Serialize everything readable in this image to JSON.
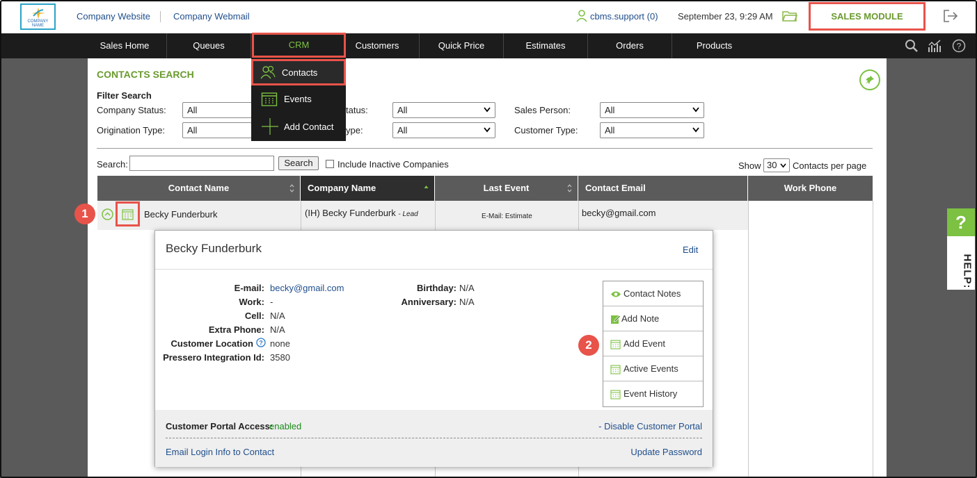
{
  "header": {
    "logo_text": "COMPANY NAME",
    "links": [
      "Company Website",
      "Company Webmail"
    ],
    "user": "cbms.support (0)",
    "datetime": "September 23, 9:29 AM",
    "module_button": "SALES MODULE"
  },
  "nav": {
    "items": [
      "Sales Home",
      "Queues",
      "CRM",
      "Customers",
      "Quick Price",
      "Estimates",
      "Orders",
      "Products"
    ],
    "crm_dropdown": [
      "Contacts",
      "Events",
      "Add Contact"
    ]
  },
  "page": {
    "title": "CONTACTS SEARCH",
    "filter_heading": "Filter Search",
    "filters": {
      "company_status_label": "Company Status:",
      "company_status_value": "All",
      "status_label_partial": "tatus:",
      "status_value": "All",
      "sales_person_label": "Sales Person:",
      "sales_person_value": "All",
      "origination_type_label": "Origination Type:",
      "origination_type_value": "All",
      "type_label_partial": "ype:",
      "type_value": "All",
      "customer_type_label": "Customer Type:",
      "customer_type_value": "All"
    },
    "search_label": "Search:",
    "search_button": "Search",
    "include_inactive_label": "Include Inactive Companies",
    "show_label": "Show",
    "per_page_value": "30",
    "per_page_suffix": "Contacts per page"
  },
  "table": {
    "columns": [
      "Contact Name",
      "Company Name",
      "Last Event",
      "Contact Email",
      "Work Phone"
    ],
    "row": {
      "contact_name": "Becky Funderburk",
      "company_name": "(IH) Becky Funderburk",
      "company_tag": "- Lead",
      "last_event": "E-Mail: Estimate",
      "email": "becky@gmail.com"
    }
  },
  "card": {
    "name": "Becky Funderburk",
    "edit": "Edit",
    "fields": [
      {
        "label": "E-mail:",
        "value": "becky@gmail.com"
      },
      {
        "label": "Work:",
        "value": "-"
      },
      {
        "label": "Cell:",
        "value": "N/A"
      },
      {
        "label": "Extra Phone:",
        "value": "N/A"
      },
      {
        "label": "Customer Location",
        "value": "none"
      },
      {
        "label": "Pressero Integration Id:",
        "value": "3580"
      }
    ],
    "fields_right": [
      {
        "label": "Birthday:",
        "value": "N/A"
      },
      {
        "label": "Anniversary:",
        "value": "N/A"
      }
    ],
    "actions": [
      "Contact Notes",
      "Add Note",
      "Add Event",
      "Active Events",
      "Event History"
    ],
    "portal_label": "Customer Portal Access:",
    "portal_status": "enabled",
    "disable_portal": "- Disable Customer Portal",
    "email_login": "Email Login Info to Contact",
    "update_password": "Update Password"
  },
  "callouts": [
    "1",
    "2"
  ],
  "help_tab": {
    "symbol": "?",
    "label": "HELP:"
  },
  "colors": {
    "accent_green": "#7cc142",
    "callout_red": "#e8534a",
    "link_blue": "#1f4e8c",
    "nav_dark": "#1c1c1c"
  }
}
